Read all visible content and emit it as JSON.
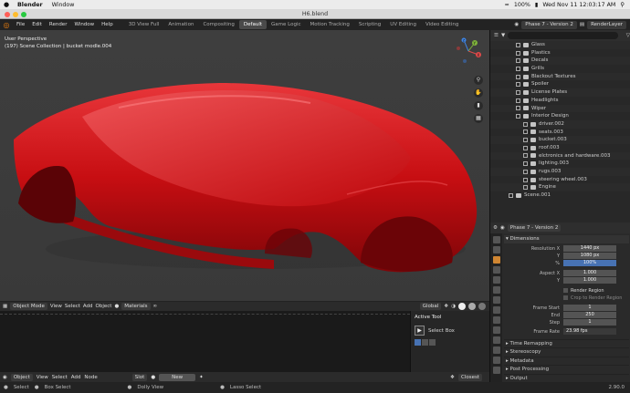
{
  "mac": {
    "apple": "",
    "app": "Blender",
    "menus": [
      "Window"
    ],
    "battery": "100%",
    "clock": "Wed Nov 11  12:03:17 AM"
  },
  "window": {
    "title": "H6.blend"
  },
  "topbar": {
    "menus": [
      "File",
      "Edit",
      "Render",
      "Window",
      "Help"
    ],
    "workspaces": [
      "3D View Full",
      "Animation",
      "Compositing",
      "Default",
      "Game Logic",
      "Motion Tracking",
      "Scripting",
      "UV Editing",
      "Video Editing"
    ],
    "active_workspace": "Default",
    "scene": "Phase 7 - Version 2",
    "view_layer": "RenderLayer"
  },
  "viewport": {
    "view_name": "User Perspective",
    "collection": "(197) Scene Collection | bucket modle.004",
    "car_color": "#d40f14",
    "gizmo": {
      "x": "X",
      "y": "Y",
      "z": "Z"
    }
  },
  "viewport_header": {
    "mode": "Object Mode",
    "menus": [
      "View",
      "Select",
      "Add",
      "Object"
    ],
    "materials": "Materials",
    "transform": "Global"
  },
  "tool_panel": {
    "title": "Active Tool",
    "tool": "Select Box"
  },
  "node_bar": {
    "type": "Object",
    "menus": [
      "View",
      "Select",
      "Add",
      "Node"
    ],
    "slot": "Slot",
    "new_label": "New",
    "closest": "Closest"
  },
  "status": {
    "items": [
      "Select",
      "Box Select",
      "Dolly View",
      "Lasso Select"
    ],
    "version": "2.90.0"
  },
  "outliner": {
    "rows": [
      {
        "label": "Glass",
        "indent": 1
      },
      {
        "label": "Plastics",
        "indent": 1
      },
      {
        "label": "Decals",
        "indent": 1
      },
      {
        "label": "Grills",
        "indent": 1
      },
      {
        "label": "Blackout Textures",
        "indent": 1
      },
      {
        "label": "Spoiler",
        "indent": 1
      },
      {
        "label": "License Plates",
        "indent": 1
      },
      {
        "label": "Headlights",
        "indent": 1
      },
      {
        "label": "Wiper",
        "indent": 1
      },
      {
        "label": "Interior Design",
        "indent": 1
      },
      {
        "label": "driver.002",
        "indent": 2
      },
      {
        "label": "seats.003",
        "indent": 2
      },
      {
        "label": "bucket.003",
        "indent": 2
      },
      {
        "label": "roof.003",
        "indent": 2
      },
      {
        "label": "elctronics and hardware.003",
        "indent": 2
      },
      {
        "label": "lighting.003",
        "indent": 2
      },
      {
        "label": "rugs.003",
        "indent": 2
      },
      {
        "label": "steering wheel.003",
        "indent": 2
      },
      {
        "label": "Engine",
        "indent": 2
      },
      {
        "label": "Scene.001",
        "indent": 0
      }
    ]
  },
  "properties": {
    "scene": "Phase 7 - Version 2",
    "panel": "Dimensions",
    "res_x_label": "Resolution X",
    "res_x": "1440 px",
    "y_label": "Y",
    "res_y": "1080 px",
    "pct_label": "%",
    "pct": "100%",
    "aspect_x_label": "Aspect X",
    "aspect_x": "1.000",
    "aspect_y_label": "Y",
    "aspect_y": "1.000",
    "render_region": "Render Region",
    "crop": "Crop to Render Region",
    "frame_start_label": "Frame Start",
    "frame_start": "1",
    "end_label": "End",
    "end": "250",
    "step_label": "Step",
    "step": "1",
    "frame_rate_label": "Frame Rate",
    "frame_rate": "23.98 fps",
    "subpanels": [
      "Time Remapping",
      "Stereoscopy",
      "Metadata",
      "Post Processing",
      "Output"
    ]
  }
}
